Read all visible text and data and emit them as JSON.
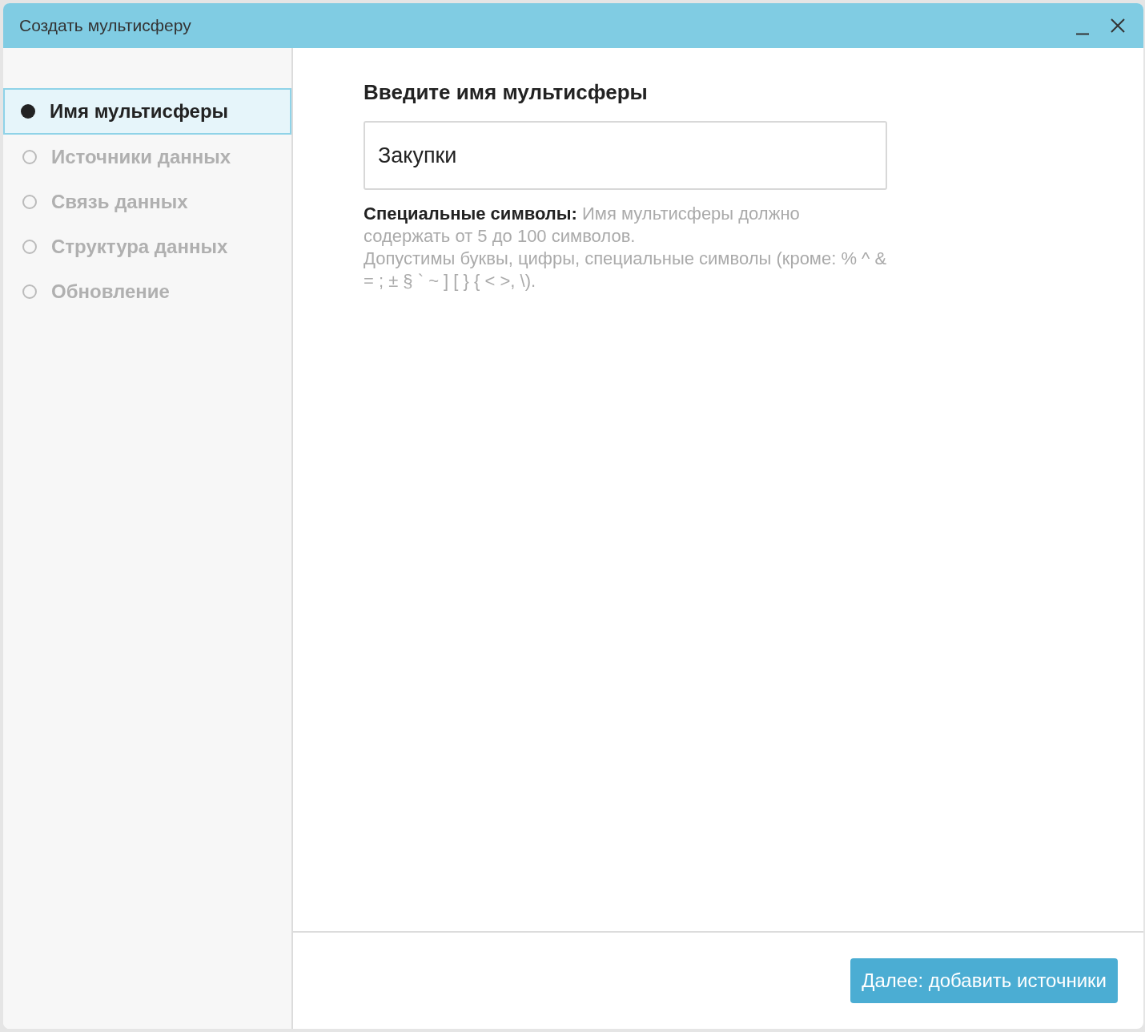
{
  "window": {
    "title": "Создать мультисферу"
  },
  "steps": [
    {
      "label": "Имя мультисферы",
      "selected": true
    },
    {
      "label": "Источники данных",
      "selected": false
    },
    {
      "label": "Связь данных",
      "selected": false
    },
    {
      "label": "Структура данных",
      "selected": false
    },
    {
      "label": "Обновление",
      "selected": false
    }
  ],
  "form": {
    "heading": "Введите имя мультисферы",
    "value": "Закупки",
    "help": [
      "**Специальные символы:** Имя мультисферы должно содержать от 5 до 100 символов.",
      "Допустимы буквы, цифры, специальные символы (кроме: % ^ & = ; ± § ` ~ ] [ } { < >, \\)."
    ]
  },
  "footer": {
    "next_button": "Далее: добавить источники"
  }
}
